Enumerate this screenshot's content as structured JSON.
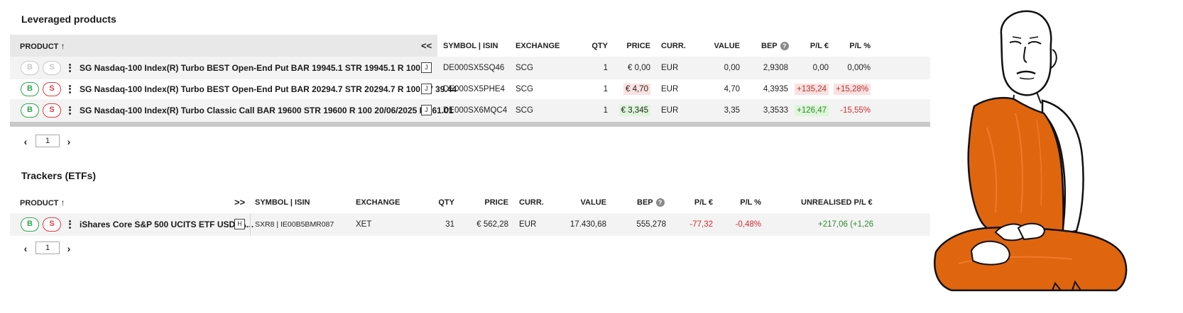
{
  "leveraged": {
    "title": "Leveraged products",
    "headers": {
      "product": "PRODUCT",
      "collapse": "<<",
      "symbol": "SYMBOL | ISIN",
      "exchange": "EXCHANGE",
      "qty": "QTY",
      "price": "PRICE",
      "curr": "CURR.",
      "value": "VALUE",
      "bep": "BEP",
      "pl_eur": "P/L €",
      "pl_pct": "P/L %"
    },
    "rows": [
      {
        "buy": "B",
        "sell": "S",
        "name": "SG Nasdaq-100 Index(R) Turbo BEST Open-End Put BAR 19945.1 STR 19945.1 R 100",
        "tag": "J",
        "isin": "DE000SX5SQ46",
        "exchange": "SCG",
        "qty": "1",
        "price": "€ 0,00",
        "curr": "EUR",
        "value": "0,00",
        "bep": "2,9308",
        "pl_eur": "0,00",
        "pl_pct": "0,00%"
      },
      {
        "buy": "B",
        "sell": "S",
        "name": "SG Nasdaq-100 Index(R) Turbo BEST Open-End Put BAR 20294.7 STR 20294.7 R 100 LV 39.44",
        "tag": "J",
        "isin": "DE000SX5PHE4",
        "exchange": "SCG",
        "qty": "1",
        "price": "€ 4,70",
        "curr": "EUR",
        "value": "4,70",
        "bep": "4,3935",
        "pl_eur": "+135,24",
        "pl_pct": "+15,28%"
      },
      {
        "buy": "B",
        "sell": "S",
        "name": "SG Nasdaq-100 Index(R) Turbo Classic Call BAR 19600 STR 19600 R 100 20/06/2025 LV 61.01",
        "tag": "J",
        "isin": "DE000SX6MQC4",
        "exchange": "SCG",
        "qty": "1",
        "price": "€ 3,345",
        "curr": "EUR",
        "value": "3,35",
        "bep": "3,3533",
        "pl_eur": "+126,47",
        "pl_pct": "-15,55%"
      }
    ],
    "page": "1"
  },
  "etfs": {
    "title": "Trackers (ETFs)",
    "headers": {
      "product": "PRODUCT",
      "expand": ">>",
      "symbol": "SYMBOL | ISIN",
      "exchange": "EXCHANGE",
      "qty": "QTY",
      "price": "PRICE",
      "curr": "CURR.",
      "value": "VALUE",
      "bep": "BEP",
      "pl_eur": "P/L €",
      "pl_pct": "P/L %",
      "unrealised": "UNREALISED P/L €"
    },
    "rows": [
      {
        "buy": "B",
        "sell": "S",
        "name": "iShares Core S&P 500 UCITS ETF USD (A...",
        "tag": "H",
        "symbol": "SXR8 | IE00B5BMR087",
        "exchange": "XET",
        "qty": "31",
        "price": "€ 562,28",
        "curr": "EUR",
        "value": "17.430,68",
        "bep": "555,278",
        "pl_eur": "-77,32",
        "pl_pct": "-0,48%",
        "unrealised": "+217,06 (+1,26"
      }
    ],
    "page": "1"
  },
  "icons": {
    "sort": "arrow-up-icon",
    "info": "info-icon",
    "more": "kebab-menu-icon",
    "prev": "chevron-left-icon",
    "next": "chevron-right-icon"
  },
  "colors": {
    "buy": "#2da84a",
    "sell": "#e3383f",
    "negative": "#d8282e",
    "positive": "#2e8b2e",
    "robe": "#e0650f"
  }
}
